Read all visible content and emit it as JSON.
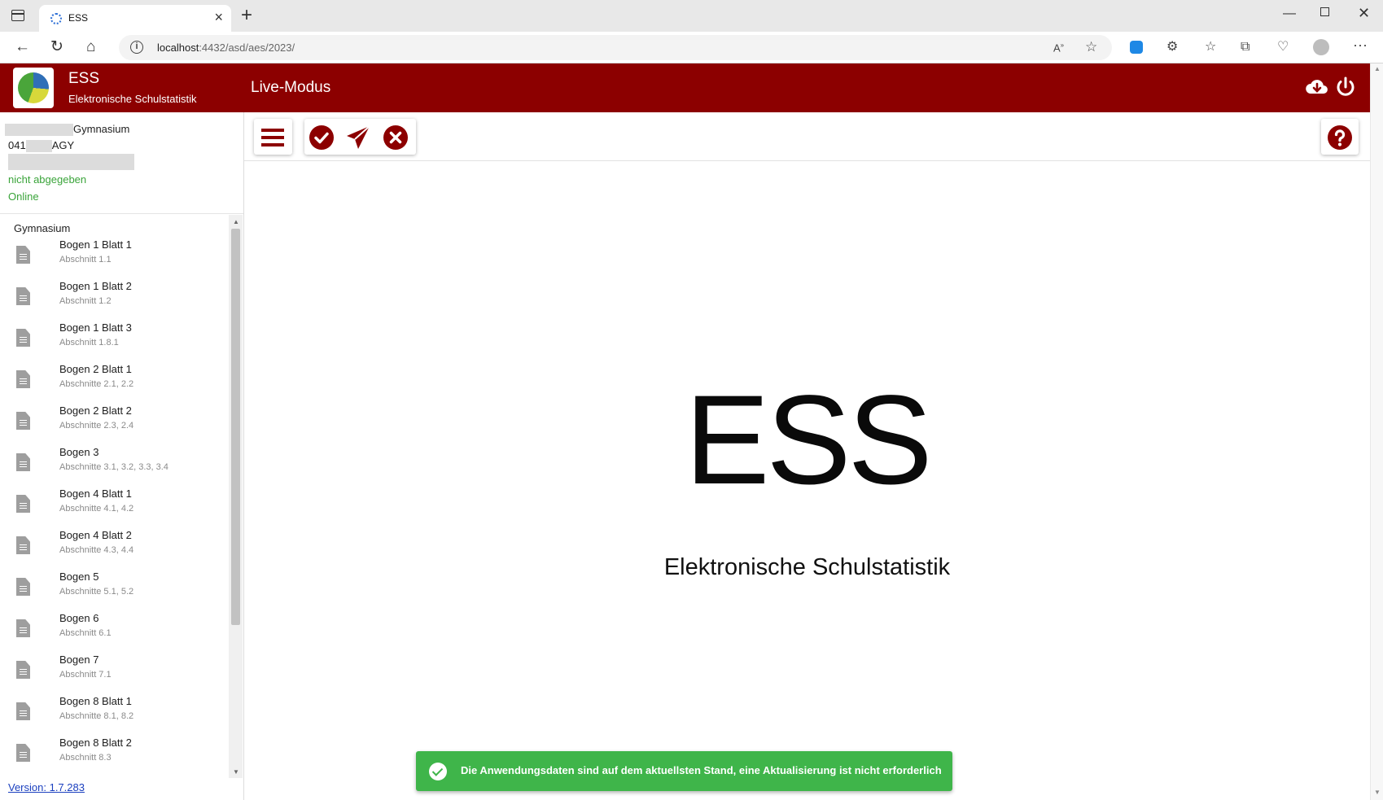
{
  "browser": {
    "tab_title": "ESS",
    "url_host": "localhost",
    "url_rest": ":4432/asd/aes/2023/"
  },
  "header": {
    "title": "ESS",
    "subtitle": "Elektronische Schulstatistik",
    "mode": "Live-Modus"
  },
  "school": {
    "type": "Gymnasium",
    "code_prefix": "041",
    "code_suffix": "AGY",
    "status": "nicht abgegeben",
    "connection": "Online"
  },
  "sidebar": {
    "heading": "Gymnasium",
    "items": [
      {
        "title": "Bogen 1 Blatt 1",
        "sub": "Abschnitt 1.1"
      },
      {
        "title": "Bogen 1 Blatt 2",
        "sub": "Abschnitt 1.2"
      },
      {
        "title": "Bogen 1 Blatt 3",
        "sub": "Abschnitt 1.8.1"
      },
      {
        "title": "Bogen 2 Blatt 1",
        "sub": "Abschnitte 2.1, 2.2"
      },
      {
        "title": "Bogen 2 Blatt 2",
        "sub": "Abschnitte 2.3, 2.4"
      },
      {
        "title": "Bogen 3",
        "sub": "Abschnitte 3.1, 3.2, 3.3, 3.4"
      },
      {
        "title": "Bogen 4 Blatt 1",
        "sub": "Abschnitte 4.1, 4.2"
      },
      {
        "title": "Bogen 4 Blatt 2",
        "sub": "Abschnitte 4.3, 4.4"
      },
      {
        "title": "Bogen 5",
        "sub": "Abschnitte 5.1, 5.2"
      },
      {
        "title": "Bogen 6",
        "sub": "Abschnitt 6.1"
      },
      {
        "title": "Bogen 7",
        "sub": "Abschnitt 7.1"
      },
      {
        "title": "Bogen 8 Blatt 1",
        "sub": "Abschnitte 8.1, 8.2"
      },
      {
        "title": "Bogen 8 Blatt 2",
        "sub": "Abschnitt 8.3"
      }
    ],
    "version": "Version: 1.7.283"
  },
  "main": {
    "title": "ESS",
    "subtitle": "Elektronische Schulstatistik"
  },
  "snackbar": {
    "message": "Die Anwendungsdaten sind auf dem aktuellsten Stand, eine Aktualisierung ist nicht erforderlich"
  },
  "colors": {
    "header": "#8c0000",
    "accent_icon": "#8c0000",
    "success": "#3fb54a",
    "status_green": "#3aa43a"
  }
}
